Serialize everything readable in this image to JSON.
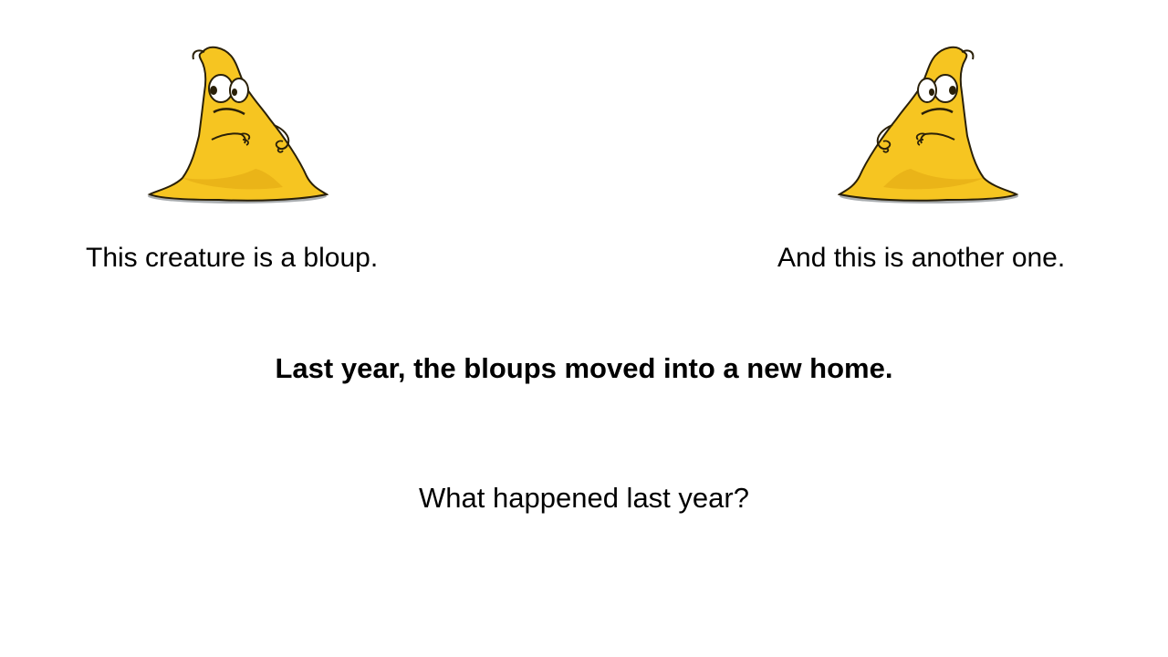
{
  "slide": {
    "left_caption": "This creature is a bloup.",
    "right_caption": "And this is another one.",
    "statement": "Last year, the bloups moved into a new home.",
    "question": "What happened last year?"
  },
  "colors": {
    "background": "#ffffff",
    "text": "#000000",
    "creature_body": "#f6c521",
    "creature_shadow": "#e0a612",
    "creature_outline": "#2a2008",
    "ground_shadow": "#8c9196"
  },
  "icons": {
    "left_creature": "yellow-blob-creature-icon",
    "right_creature": "yellow-blob-creature-icon"
  }
}
